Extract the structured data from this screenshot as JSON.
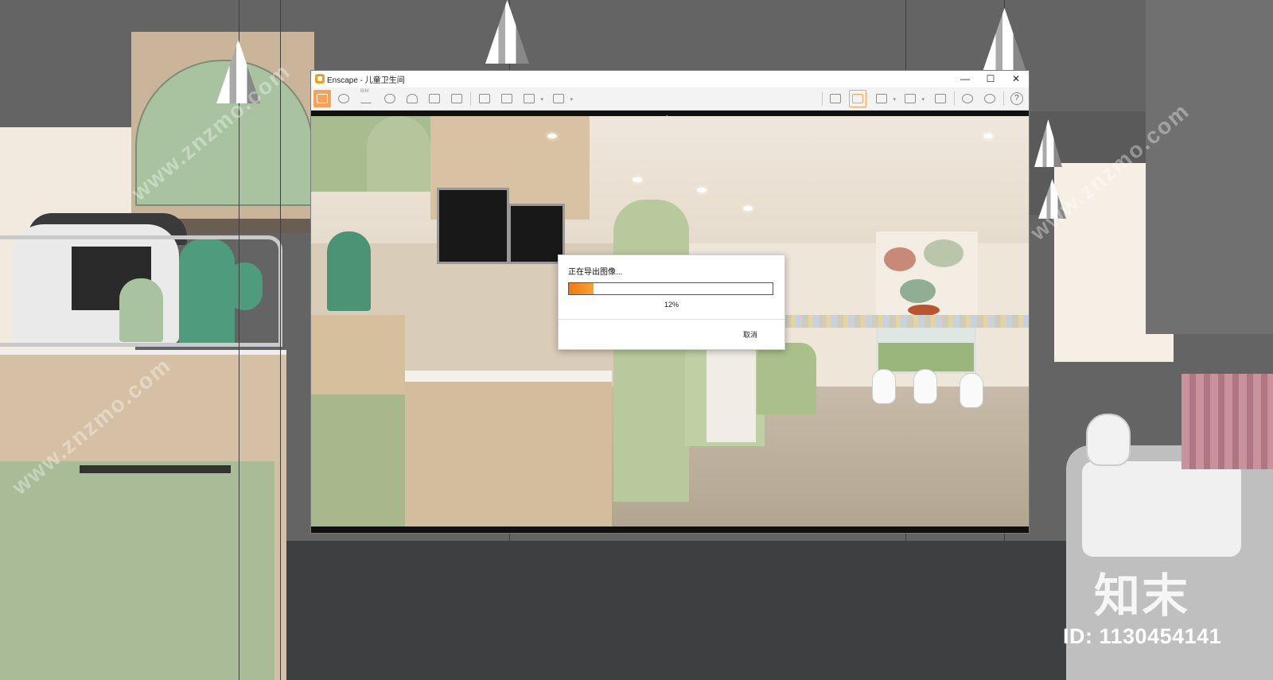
{
  "window": {
    "app_name": "Enscape",
    "title": "Enscape - 儿童卫生间",
    "minimize_glyph": "—",
    "maximize_glyph": "☐",
    "close_glyph": "✕"
  },
  "toolbar": {
    "left_tools": [
      "home-icon",
      "render-settings-icon",
      "bim-icon",
      "binoculars-icon",
      "asset-library-icon",
      "buildings-icon",
      "clapper-icon"
    ],
    "export_tools": [
      "screenshot-export-icon",
      "batch-export-icon",
      "panorama-export-icon",
      "exe-export-icon"
    ],
    "right_tools": [
      "map-icon",
      "material-editor-icon",
      "cube-icon",
      "views-icon",
      "vr-headset-icon",
      "eye-icon",
      "gear-icon",
      "help-icon"
    ],
    "bim_label": "BIM",
    "collapse_caret": "^",
    "help_glyph": "?",
    "active_tool": "home-icon",
    "accent_color": "#f7a25b"
  },
  "dialog": {
    "title": "正在导出图像...",
    "progress_percent": 12,
    "progress_label": "12%",
    "cancel_label": "取消",
    "progress_color": "#f07a10"
  },
  "branding": {
    "logo_text": "知末",
    "id_label": "ID: 1130454141",
    "watermark_text": "www.znzmo.com"
  }
}
